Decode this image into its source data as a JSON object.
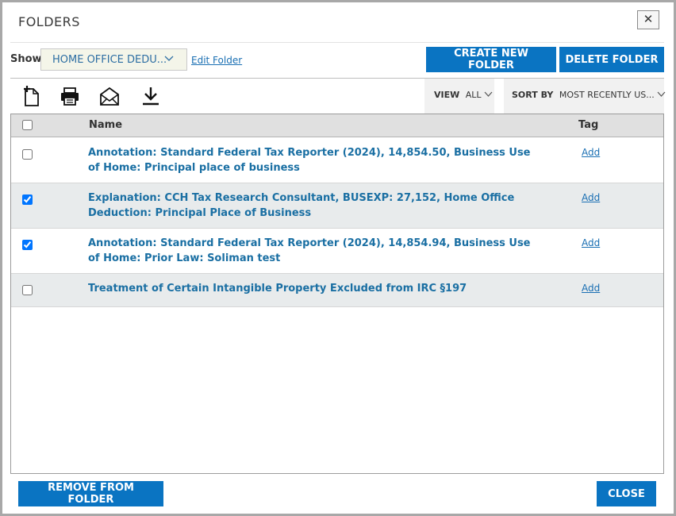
{
  "dialog": {
    "title": "FOLDERS",
    "close_x": "✕"
  },
  "filter": {
    "show_label": "Show",
    "folder_selected": "HOME OFFICE DEDU...",
    "edit_folder_label": "Edit Folder"
  },
  "actions": {
    "create_label": "CREATE NEW FOLDER",
    "delete_label": "DELETE FOLDER"
  },
  "toolbar": {
    "icons": [
      "new-document-icon",
      "print-icon",
      "email-icon",
      "download-icon"
    ],
    "view_label": "VIEW",
    "view_value": "ALL",
    "sort_label": "SORT BY",
    "sort_value": "MOST RECENTLY US..."
  },
  "table": {
    "columns": {
      "name": "Name",
      "tag": "Tag"
    },
    "rows": [
      {
        "title": "Annotation: Standard Federal Tax Reporter (2024), 14,854.50, Business Use of Home: Principal place of business",
        "checked": false,
        "tag": "Add"
      },
      {
        "title": "Explanation: CCH Tax Research Consultant, BUSEXP: 27,152, Home Office Deduction: Principal Place of Business",
        "checked": true,
        "tag": "Add"
      },
      {
        "title": "Annotation: Standard Federal Tax Reporter (2024), 14,854.94, Business Use of Home: Prior Law: Soliman test",
        "checked": true,
        "tag": "Add"
      },
      {
        "title": "Treatment of Certain Intangible Property Excluded from IRC §197",
        "checked": false,
        "tag": "Add"
      }
    ]
  },
  "footer": {
    "remove_label": "REMOVE FROM FOLDER",
    "close_label": "CLOSE"
  },
  "colors": {
    "accent": "#0a74c2",
    "link": "#1a6fa3",
    "row_alt": "#e8ebec",
    "header": "#e0e0e0"
  }
}
